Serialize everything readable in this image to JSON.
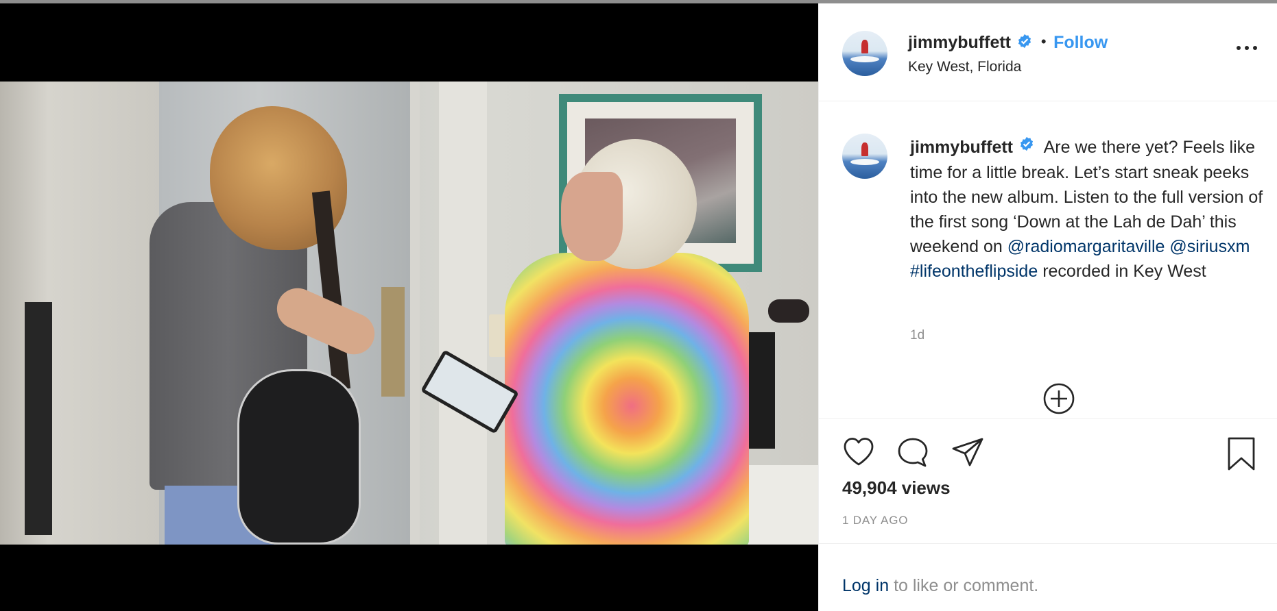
{
  "post": {
    "username": "jimmybuffett",
    "location": "Key West, Florida",
    "follow_label": "Follow",
    "separator": "•",
    "caption": {
      "text_1": "Are we there yet? Feels like time for a little break. Let’s start sneak peeks into the new album. Listen to the full version of the first song ‘Down at the Lah de Dah’ this weekend on",
      "mention_1": "@radiomargaritaville",
      "mention_2": "@siriusxm",
      "hashtag": "#lifeontheflipside",
      "text_2": "recorded in Key West"
    },
    "age": "1d",
    "views": "49,904 views",
    "date": "1 DAY AGO",
    "login_link": "Log in",
    "login_rest": " to like or comment."
  },
  "icons": {
    "verified": "verified-badge-icon",
    "more": "more-options-icon",
    "load_more": "plus-circle-icon",
    "like": "heart-icon",
    "comment": "comment-icon",
    "share": "paper-plane-icon",
    "save": "bookmark-icon"
  },
  "colors": {
    "link": "#003569",
    "follow": "#3897f0",
    "verified": "#3897f0",
    "muted": "#8e8e8e"
  }
}
